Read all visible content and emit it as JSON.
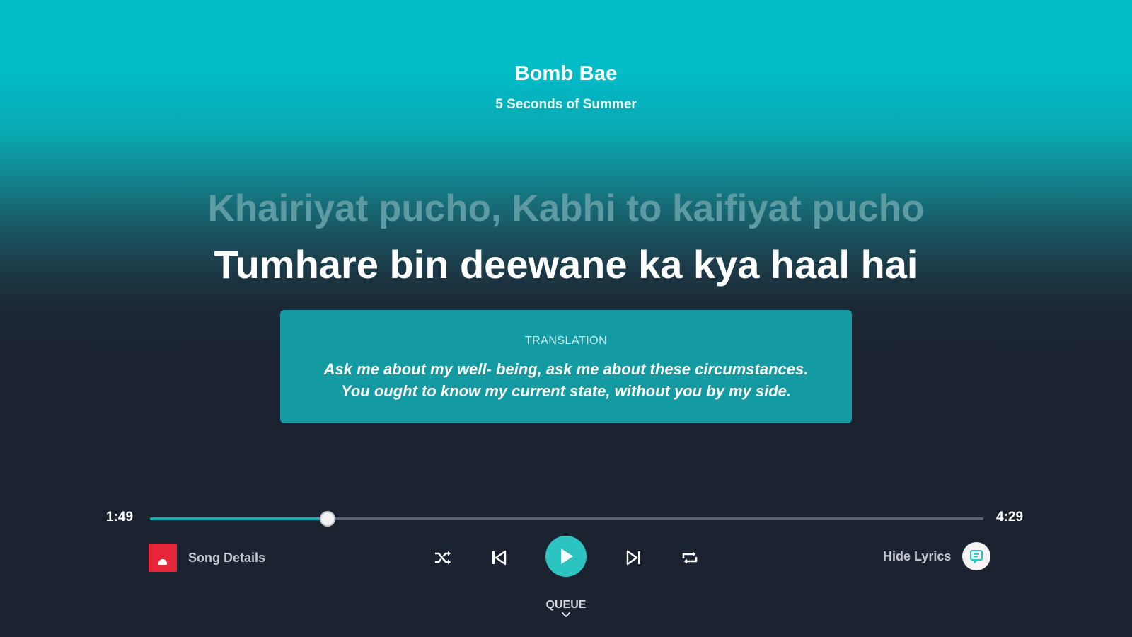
{
  "song": {
    "title": "Bomb Bae",
    "artist": "5 Seconds of Summer"
  },
  "lyrics": {
    "previous_line": "Khairiyat pucho, Kabhi to kaifiyat pucho",
    "current_line": "Tumhare bin deewane ka kya haal hai"
  },
  "translation": {
    "heading": "TRANSLATION",
    "text": "Ask me about my well- being, ask me about these circumstances. You ought to know my current state, without you by my side."
  },
  "player": {
    "elapsed": "1:49",
    "duration": "4:29",
    "progress_fraction": 0.2133,
    "song_details_label": "Song Details",
    "hide_lyrics_label": "Hide Lyrics",
    "queue_label": "QUEUE"
  },
  "icons": {
    "shuffle": "shuffle-icon",
    "previous": "skip-previous-icon",
    "play": "play-icon",
    "next": "skip-next-icon",
    "repeat": "repeat-icon",
    "lyrics_toggle": "lyrics-icon",
    "queue": "chevron-down-icon",
    "album": "album-art"
  },
  "colors": {
    "accent": "#2bc4c1",
    "translation_bg": "#149aa2",
    "background_top": "#02bcc8",
    "background_bottom": "#1b2230",
    "album_art": "#e8273b"
  }
}
